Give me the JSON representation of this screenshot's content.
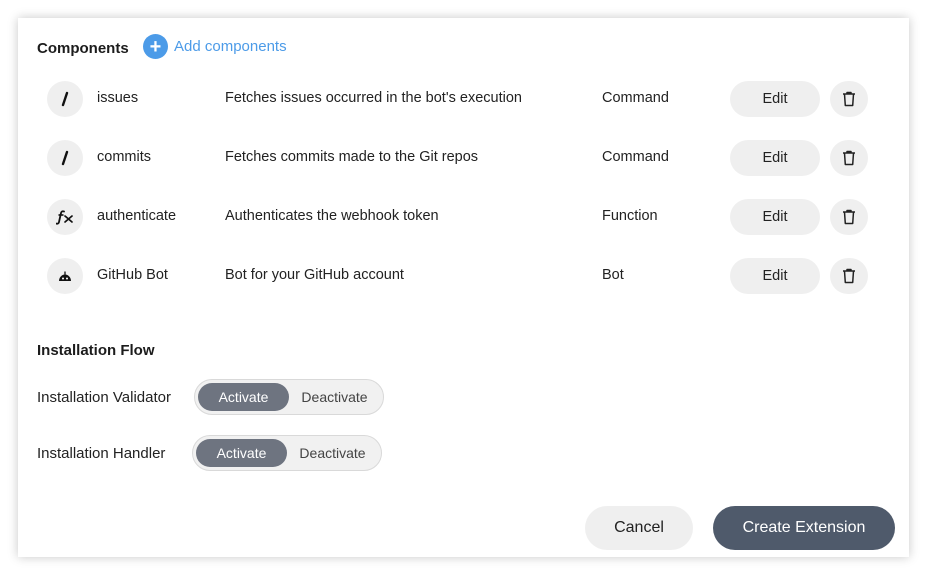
{
  "components": {
    "title": "Components",
    "add_label": "Add components",
    "add_icon": "plus-icon",
    "items": [
      {
        "icon": "slash-icon",
        "name": "issues",
        "description": "Fetches issues occurred in the bot's execution",
        "type": "Command",
        "edit_label": "Edit"
      },
      {
        "icon": "slash-icon",
        "name": "commits",
        "description": "Fetches commits made to the Git repos",
        "type": "Command",
        "edit_label": "Edit"
      },
      {
        "icon": "function-icon",
        "name": "authenticate",
        "description": "Authenticates the webhook token",
        "type": "Function",
        "edit_label": "Edit"
      },
      {
        "icon": "bot-icon",
        "name": "GitHub Bot",
        "description": "Bot for your GitHub account",
        "type": "Bot",
        "edit_label": "Edit"
      }
    ]
  },
  "installation_flow": {
    "title": "Installation Flow",
    "validator": {
      "label": "Installation Validator",
      "options": [
        "Activate",
        "Deactivate"
      ],
      "selected": "Activate"
    },
    "handler": {
      "label": "Installation Handler",
      "options": [
        "Activate",
        "Deactivate"
      ],
      "selected": "Activate"
    }
  },
  "footer": {
    "cancel_label": "Cancel",
    "create_label": "Create Extension"
  },
  "colors": {
    "accent": "#4c9be8",
    "primary_button": "#4f5a6b",
    "toggle_active": "#6e7480",
    "chip_bg": "#efefef"
  }
}
